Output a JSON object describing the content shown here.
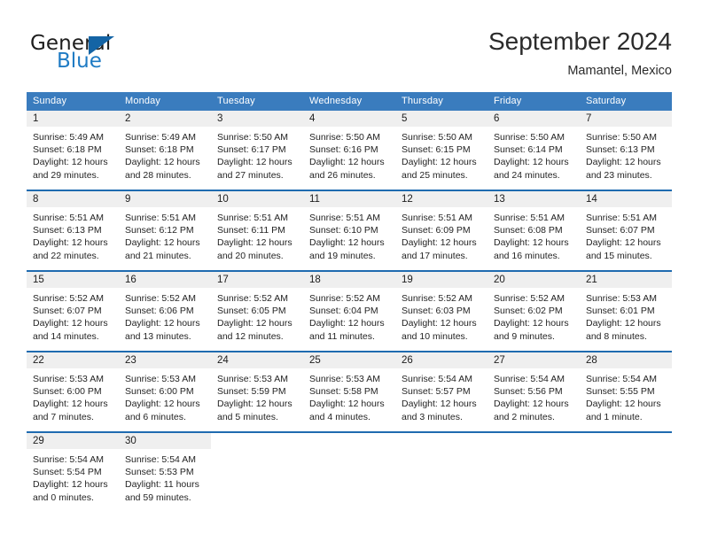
{
  "brand": {
    "name_part1": "General",
    "name_part2": "Blue",
    "flag_icon": "blue-triangle-flag"
  },
  "header": {
    "title": "September 2024",
    "location": "Mamantel, Mexico"
  },
  "colors": {
    "header_blue": "#3a7cbe",
    "row_divider_blue": "#1f6bb0",
    "day_band_gray": "#efefef",
    "brand_blue": "#1f7bc4",
    "flag_blue": "#1464a5"
  },
  "weekdays": [
    "Sunday",
    "Monday",
    "Tuesday",
    "Wednesday",
    "Thursday",
    "Friday",
    "Saturday"
  ],
  "weeks": [
    [
      {
        "day": "1",
        "sunrise": "Sunrise: 5:49 AM",
        "sunset": "Sunset: 6:18 PM",
        "daylight_line1": "Daylight: 12 hours",
        "daylight_line2": "and 29 minutes."
      },
      {
        "day": "2",
        "sunrise": "Sunrise: 5:49 AM",
        "sunset": "Sunset: 6:18 PM",
        "daylight_line1": "Daylight: 12 hours",
        "daylight_line2": "and 28 minutes."
      },
      {
        "day": "3",
        "sunrise": "Sunrise: 5:50 AM",
        "sunset": "Sunset: 6:17 PM",
        "daylight_line1": "Daylight: 12 hours",
        "daylight_line2": "and 27 minutes."
      },
      {
        "day": "4",
        "sunrise": "Sunrise: 5:50 AM",
        "sunset": "Sunset: 6:16 PM",
        "daylight_line1": "Daylight: 12 hours",
        "daylight_line2": "and 26 minutes."
      },
      {
        "day": "5",
        "sunrise": "Sunrise: 5:50 AM",
        "sunset": "Sunset: 6:15 PM",
        "daylight_line1": "Daylight: 12 hours",
        "daylight_line2": "and 25 minutes."
      },
      {
        "day": "6",
        "sunrise": "Sunrise: 5:50 AM",
        "sunset": "Sunset: 6:14 PM",
        "daylight_line1": "Daylight: 12 hours",
        "daylight_line2": "and 24 minutes."
      },
      {
        "day": "7",
        "sunrise": "Sunrise: 5:50 AM",
        "sunset": "Sunset: 6:13 PM",
        "daylight_line1": "Daylight: 12 hours",
        "daylight_line2": "and 23 minutes."
      }
    ],
    [
      {
        "day": "8",
        "sunrise": "Sunrise: 5:51 AM",
        "sunset": "Sunset: 6:13 PM",
        "daylight_line1": "Daylight: 12 hours",
        "daylight_line2": "and 22 minutes."
      },
      {
        "day": "9",
        "sunrise": "Sunrise: 5:51 AM",
        "sunset": "Sunset: 6:12 PM",
        "daylight_line1": "Daylight: 12 hours",
        "daylight_line2": "and 21 minutes."
      },
      {
        "day": "10",
        "sunrise": "Sunrise: 5:51 AM",
        "sunset": "Sunset: 6:11 PM",
        "daylight_line1": "Daylight: 12 hours",
        "daylight_line2": "and 20 minutes."
      },
      {
        "day": "11",
        "sunrise": "Sunrise: 5:51 AM",
        "sunset": "Sunset: 6:10 PM",
        "daylight_line1": "Daylight: 12 hours",
        "daylight_line2": "and 19 minutes."
      },
      {
        "day": "12",
        "sunrise": "Sunrise: 5:51 AM",
        "sunset": "Sunset: 6:09 PM",
        "daylight_line1": "Daylight: 12 hours",
        "daylight_line2": "and 17 minutes."
      },
      {
        "day": "13",
        "sunrise": "Sunrise: 5:51 AM",
        "sunset": "Sunset: 6:08 PM",
        "daylight_line1": "Daylight: 12 hours",
        "daylight_line2": "and 16 minutes."
      },
      {
        "day": "14",
        "sunrise": "Sunrise: 5:51 AM",
        "sunset": "Sunset: 6:07 PM",
        "daylight_line1": "Daylight: 12 hours",
        "daylight_line2": "and 15 minutes."
      }
    ],
    [
      {
        "day": "15",
        "sunrise": "Sunrise: 5:52 AM",
        "sunset": "Sunset: 6:07 PM",
        "daylight_line1": "Daylight: 12 hours",
        "daylight_line2": "and 14 minutes."
      },
      {
        "day": "16",
        "sunrise": "Sunrise: 5:52 AM",
        "sunset": "Sunset: 6:06 PM",
        "daylight_line1": "Daylight: 12 hours",
        "daylight_line2": "and 13 minutes."
      },
      {
        "day": "17",
        "sunrise": "Sunrise: 5:52 AM",
        "sunset": "Sunset: 6:05 PM",
        "daylight_line1": "Daylight: 12 hours",
        "daylight_line2": "and 12 minutes."
      },
      {
        "day": "18",
        "sunrise": "Sunrise: 5:52 AM",
        "sunset": "Sunset: 6:04 PM",
        "daylight_line1": "Daylight: 12 hours",
        "daylight_line2": "and 11 minutes."
      },
      {
        "day": "19",
        "sunrise": "Sunrise: 5:52 AM",
        "sunset": "Sunset: 6:03 PM",
        "daylight_line1": "Daylight: 12 hours",
        "daylight_line2": "and 10 minutes."
      },
      {
        "day": "20",
        "sunrise": "Sunrise: 5:52 AM",
        "sunset": "Sunset: 6:02 PM",
        "daylight_line1": "Daylight: 12 hours",
        "daylight_line2": "and 9 minutes."
      },
      {
        "day": "21",
        "sunrise": "Sunrise: 5:53 AM",
        "sunset": "Sunset: 6:01 PM",
        "daylight_line1": "Daylight: 12 hours",
        "daylight_line2": "and 8 minutes."
      }
    ],
    [
      {
        "day": "22",
        "sunrise": "Sunrise: 5:53 AM",
        "sunset": "Sunset: 6:00 PM",
        "daylight_line1": "Daylight: 12 hours",
        "daylight_line2": "and 7 minutes."
      },
      {
        "day": "23",
        "sunrise": "Sunrise: 5:53 AM",
        "sunset": "Sunset: 6:00 PM",
        "daylight_line1": "Daylight: 12 hours",
        "daylight_line2": "and 6 minutes."
      },
      {
        "day": "24",
        "sunrise": "Sunrise: 5:53 AM",
        "sunset": "Sunset: 5:59 PM",
        "daylight_line1": "Daylight: 12 hours",
        "daylight_line2": "and 5 minutes."
      },
      {
        "day": "25",
        "sunrise": "Sunrise: 5:53 AM",
        "sunset": "Sunset: 5:58 PM",
        "daylight_line1": "Daylight: 12 hours",
        "daylight_line2": "and 4 minutes."
      },
      {
        "day": "26",
        "sunrise": "Sunrise: 5:54 AM",
        "sunset": "Sunset: 5:57 PM",
        "daylight_line1": "Daylight: 12 hours",
        "daylight_line2": "and 3 minutes."
      },
      {
        "day": "27",
        "sunrise": "Sunrise: 5:54 AM",
        "sunset": "Sunset: 5:56 PM",
        "daylight_line1": "Daylight: 12 hours",
        "daylight_line2": "and 2 minutes."
      },
      {
        "day": "28",
        "sunrise": "Sunrise: 5:54 AM",
        "sunset": "Sunset: 5:55 PM",
        "daylight_line1": "Daylight: 12 hours",
        "daylight_line2": "and 1 minute."
      }
    ],
    [
      {
        "day": "29",
        "sunrise": "Sunrise: 5:54 AM",
        "sunset": "Sunset: 5:54 PM",
        "daylight_line1": "Daylight: 12 hours",
        "daylight_line2": "and 0 minutes."
      },
      {
        "day": "30",
        "sunrise": "Sunrise: 5:54 AM",
        "sunset": "Sunset: 5:53 PM",
        "daylight_line1": "Daylight: 11 hours",
        "daylight_line2": "and 59 minutes."
      },
      {
        "day": "",
        "sunrise": "",
        "sunset": "",
        "daylight_line1": "",
        "daylight_line2": ""
      },
      {
        "day": "",
        "sunrise": "",
        "sunset": "",
        "daylight_line1": "",
        "daylight_line2": ""
      },
      {
        "day": "",
        "sunrise": "",
        "sunset": "",
        "daylight_line1": "",
        "daylight_line2": ""
      },
      {
        "day": "",
        "sunrise": "",
        "sunset": "",
        "daylight_line1": "",
        "daylight_line2": ""
      },
      {
        "day": "",
        "sunrise": "",
        "sunset": "",
        "daylight_line1": "",
        "daylight_line2": ""
      }
    ]
  ]
}
